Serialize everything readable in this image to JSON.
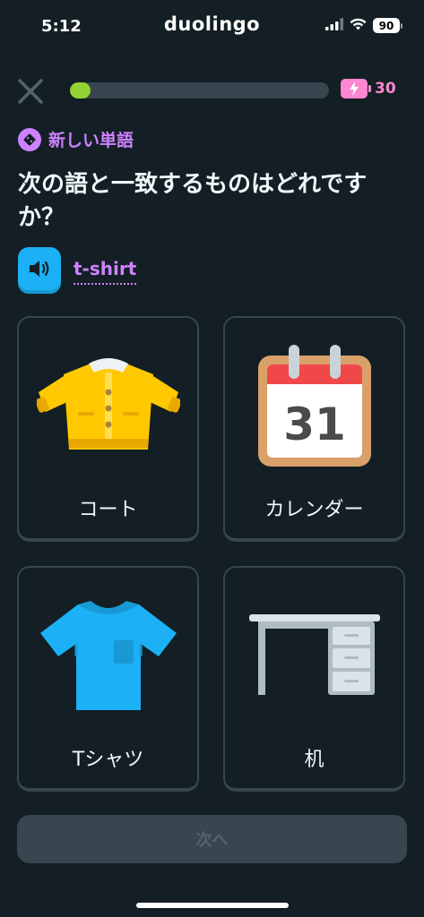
{
  "status_bar": {
    "time": "5:12",
    "app_name": "duolingo",
    "battery": "90"
  },
  "lesson": {
    "progress": 0.08,
    "energy_count": "30"
  },
  "tag": {
    "label": "新しい単語"
  },
  "question": {
    "text": "次の語と一致するものはどれですか？"
  },
  "prompt": {
    "word": "t-shirt"
  },
  "options": [
    {
      "label": "コート",
      "icon": "coat-icon"
    },
    {
      "label": "カレンダー",
      "icon": "calendar-icon",
      "calendar_day": "31"
    },
    {
      "label": "Tシャツ",
      "icon": "tshirt-icon"
    },
    {
      "label": "机",
      "icon": "desk-icon"
    }
  ],
  "footer": {
    "next_label": "次へ"
  },
  "colors": {
    "background": "#131f24",
    "accent_purple": "#ce82ff",
    "progress_green": "#93d334",
    "energy_pink": "#ff86d0",
    "audio_blue": "#1cb0f6",
    "card_border": "#37464f"
  }
}
